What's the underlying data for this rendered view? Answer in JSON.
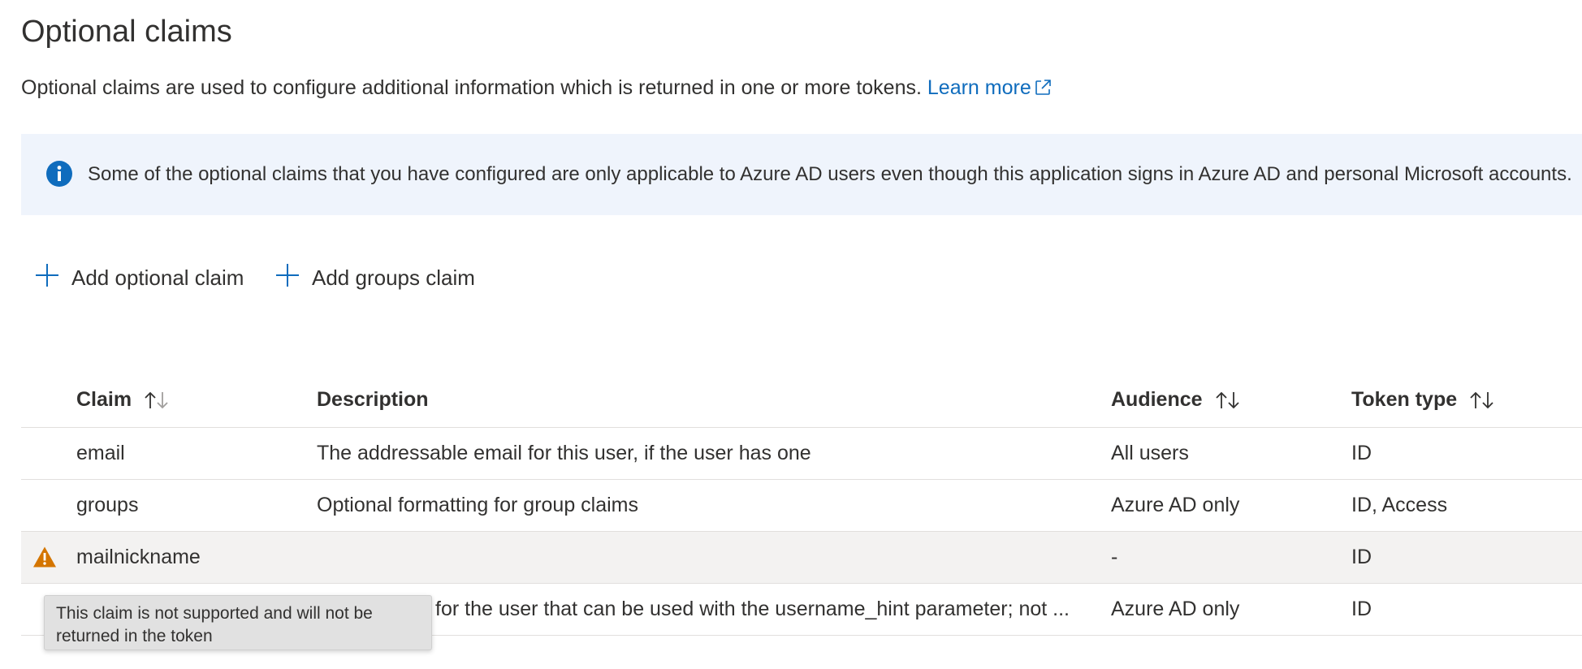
{
  "page": {
    "title": "Optional claims",
    "intro_text": "Optional claims are used to configure additional information which is returned in one or more tokens.",
    "learn_more": "Learn more"
  },
  "info_banner": {
    "icon": "info-icon",
    "text": "Some of the optional claims that you have configured are only applicable to Azure AD users even though this application signs in Azure AD and personal Microsoft accounts."
  },
  "toolbar": {
    "add_optional_claim": "Add optional claim",
    "add_groups_claim": "Add groups claim"
  },
  "table": {
    "columns": {
      "claim": "Claim",
      "description": "Description",
      "audience": "Audience",
      "token_type": "Token type"
    },
    "rows": [
      {
        "claim": "email",
        "description": "The addressable email for this user, if the user has one",
        "audience": "All users",
        "token_type": "ID"
      },
      {
        "claim": "groups",
        "description": "Optional formatting for group claims",
        "audience": "Azure AD only",
        "token_type": "ID, Access"
      },
      {
        "claim": "mailnickname",
        "description": "",
        "audience": "-",
        "token_type": "ID",
        "warning": true
      },
      {
        "claim": "",
        "description": "for the user that can be used with the username_hint parameter; not ...",
        "audience": "Azure AD only",
        "token_type": "ID"
      }
    ]
  },
  "tooltip": {
    "text": "This claim is not supported and will not be returned in the token"
  },
  "colors": {
    "accent": "#0f6cbd",
    "warning": "#d47500",
    "banner_bg": "#eff4fc"
  }
}
